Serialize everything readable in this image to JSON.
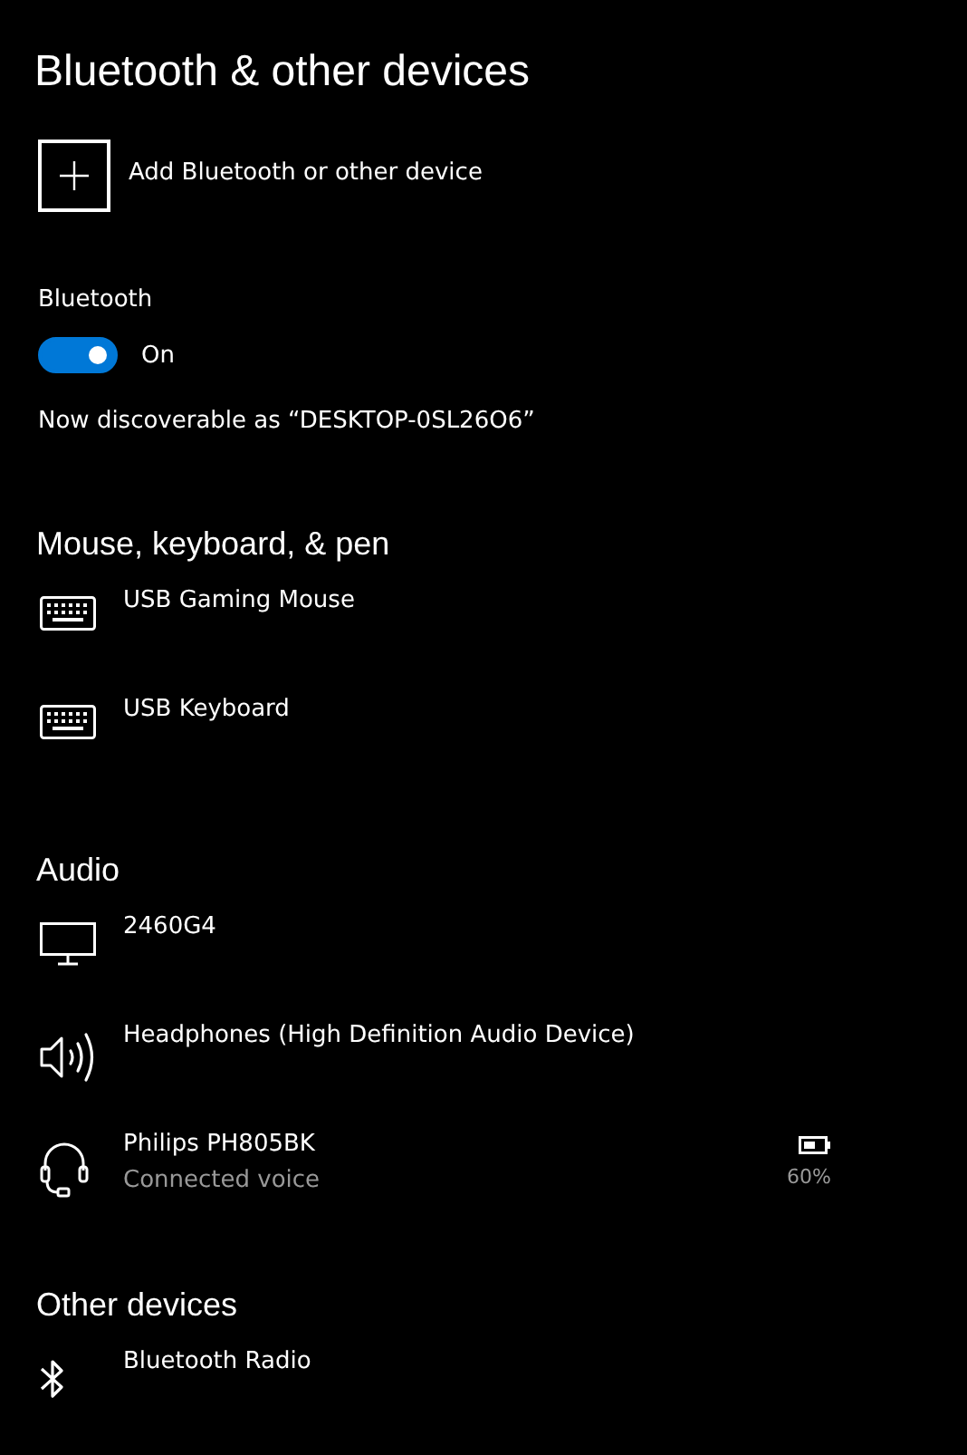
{
  "title": "Bluetooth & other devices",
  "add_button": {
    "label": "Add Bluetooth or other device"
  },
  "bluetooth": {
    "label": "Bluetooth",
    "on": true,
    "state_label": "On",
    "discoverable": "Now discoverable as “DESKTOP-0SL26O6”"
  },
  "sections": [
    {
      "heading": "Mouse, keyboard, & pen",
      "devices": [
        {
          "kind": "keyboard",
          "name": "USB Gaming Mouse"
        },
        {
          "kind": "keyboard",
          "name": "USB Keyboard"
        }
      ]
    },
    {
      "heading": "Audio",
      "devices": [
        {
          "kind": "monitor",
          "name": "2460G4"
        },
        {
          "kind": "speaker",
          "name": "Headphones (High Definition Audio Device)"
        },
        {
          "kind": "headset",
          "name": "Philips PH805BK",
          "status": "Connected voice",
          "battery": "60%"
        }
      ]
    },
    {
      "heading": "Other devices",
      "devices": [
        {
          "kind": "bluetooth",
          "name": "Bluetooth Radio"
        }
      ]
    }
  ]
}
